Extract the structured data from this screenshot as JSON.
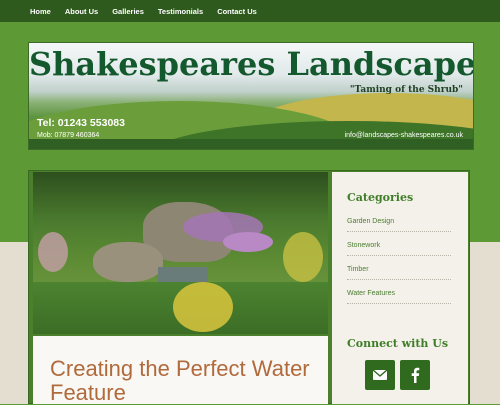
{
  "nav": {
    "items": [
      "Home",
      "About Us",
      "Galleries",
      "Testimonials",
      "Contact Us"
    ]
  },
  "banner": {
    "title": "Shakespeares Landscapes",
    "tagline": "\"Taming of the Shrub\"",
    "tel": "Tel: 01243 553083",
    "mob": "Mob: 07879 460364",
    "email": "info@landscapes-shakespeares.co.uk"
  },
  "sidebar": {
    "categories_title": "Categories",
    "categories": [
      "Garden Design",
      "Stonework",
      "Timber",
      "Water Features"
    ],
    "connect_title": "Connect with Us",
    "social": [
      "email-icon",
      "facebook-icon"
    ]
  },
  "main": {
    "post_title": "Creating the Perfect Water Feature"
  },
  "colors": {
    "nav_bg": "#2f5a1e",
    "page_green": "#5d9a35",
    "title_green": "#14592e",
    "heading_green": "#3f7d28",
    "post_title": "#b06a3c"
  }
}
